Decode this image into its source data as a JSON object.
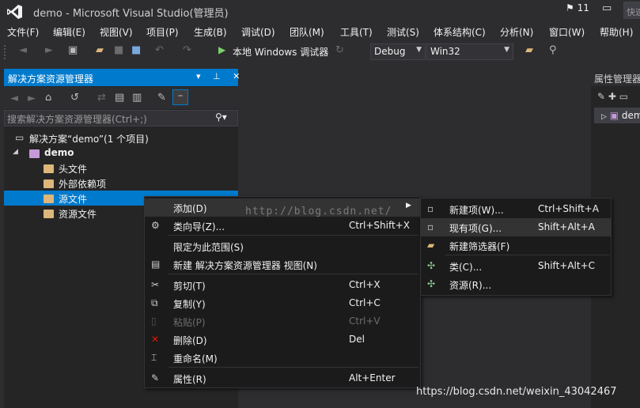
{
  "window": {
    "title": "demo - Microsoft Visual Studio(管理员)",
    "notifications": "11",
    "quick_launch": "快速"
  },
  "menu": [
    "文件(F)",
    "编辑(E)",
    "视图(V)",
    "项目(P)",
    "生成(B)",
    "调试(D)",
    "团队(M)",
    "工具(T)",
    "测试(S)",
    "体系结构(C)",
    "分析(N)",
    "窗口(W)",
    "帮助(H)"
  ],
  "toolbar": {
    "run_label": "本地 Windows 调试器",
    "config": "Debug",
    "platform": "Win32"
  },
  "solution_explorer": {
    "title": "解决方案资源管理器",
    "search_placeholder": "搜索解决方案资源管理器(Ctrl+;)",
    "solution": "解决方案“demo”(1 个项目)",
    "project": "demo",
    "items": [
      "头文件",
      "外部依赖项",
      "源文件",
      "资源文件"
    ]
  },
  "properties": {
    "title": "属性管理器",
    "item": "demo"
  },
  "context_menu": [
    {
      "label": "添加(D)",
      "shortcut": ""
    },
    {
      "label": "类向导(Z)...",
      "shortcut": "Ctrl+Shift+X"
    },
    {
      "label": "限定为此范围(S)",
      "shortcut": ""
    },
    {
      "label": "新建 解决方案资源管理器 视图(N)",
      "shortcut": ""
    },
    {
      "label": "剪切(T)",
      "shortcut": "Ctrl+X"
    },
    {
      "label": "复制(Y)",
      "shortcut": "Ctrl+C"
    },
    {
      "label": "粘贴(P)",
      "shortcut": "Ctrl+V"
    },
    {
      "label": "删除(D)",
      "shortcut": "Del"
    },
    {
      "label": "重命名(M)",
      "shortcut": ""
    },
    {
      "label": "属性(R)",
      "shortcut": "Alt+Enter"
    }
  ],
  "submenu": [
    {
      "label": "新建项(W)...",
      "shortcut": "Ctrl+Shift+A"
    },
    {
      "label": "现有项(G)...",
      "shortcut": "Shift+Alt+A"
    },
    {
      "label": "新建筛选器(F)",
      "shortcut": ""
    },
    {
      "label": "类(C)...",
      "shortcut": "Shift+Alt+C"
    },
    {
      "label": "资源(R)...",
      "shortcut": ""
    }
  ],
  "watermark": "http://blog.csdn.net/",
  "footer_url": "https://blog.csdn.net/weixin_43042467"
}
